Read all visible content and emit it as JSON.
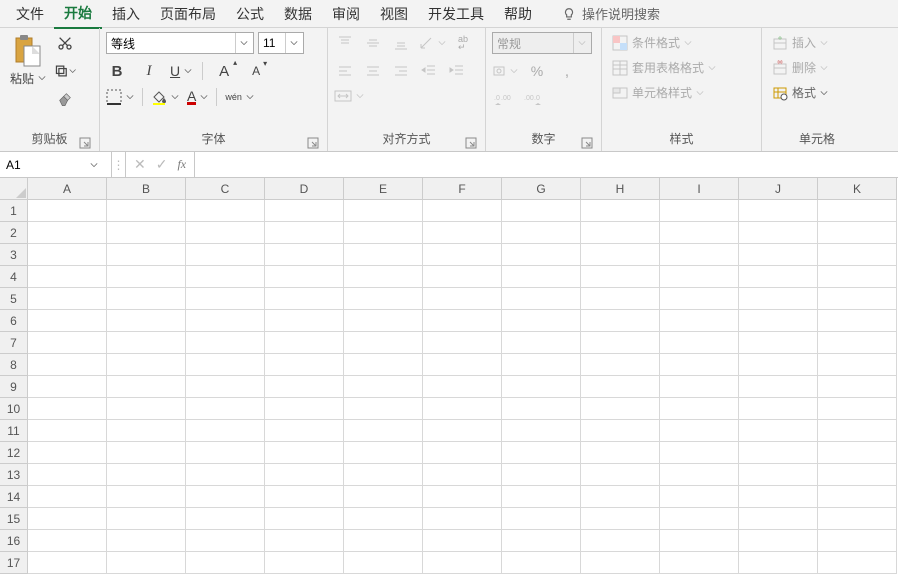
{
  "menu": {
    "tabs": [
      "文件",
      "开始",
      "插入",
      "页面布局",
      "公式",
      "数据",
      "审阅",
      "视图",
      "开发工具",
      "帮助"
    ],
    "active_index": 1,
    "search": "操作说明搜索"
  },
  "clipboard": {
    "paste": "粘贴",
    "label": "剪贴板"
  },
  "font": {
    "name": "等线",
    "size": "11",
    "bold": "B",
    "italic": "I",
    "underline": "U",
    "font_a_big": "A",
    "font_a_small": "A",
    "wen": "wén",
    "label": "字体"
  },
  "align": {
    "label": "对齐方式",
    "wrap": "ab"
  },
  "number": {
    "format": "常规",
    "percent": "%",
    "label": "数字"
  },
  "styles": {
    "conditional": "条件格式",
    "table": "套用表格格式",
    "cell": "单元格样式",
    "label": "样式"
  },
  "cells_grp": {
    "insert": "插入",
    "delete": "删除",
    "format": "格式",
    "label": "单元格"
  },
  "formula_bar": {
    "name_box": "A1",
    "fx": "fx",
    "value": ""
  },
  "grid": {
    "cols": [
      "A",
      "B",
      "C",
      "D",
      "E",
      "F",
      "G",
      "H",
      "I",
      "J",
      "K"
    ],
    "rows": [
      "1",
      "2",
      "3",
      "4",
      "5",
      "6",
      "7",
      "8",
      "9",
      "10",
      "11",
      "12",
      "13",
      "14",
      "15",
      "16",
      "17"
    ]
  }
}
